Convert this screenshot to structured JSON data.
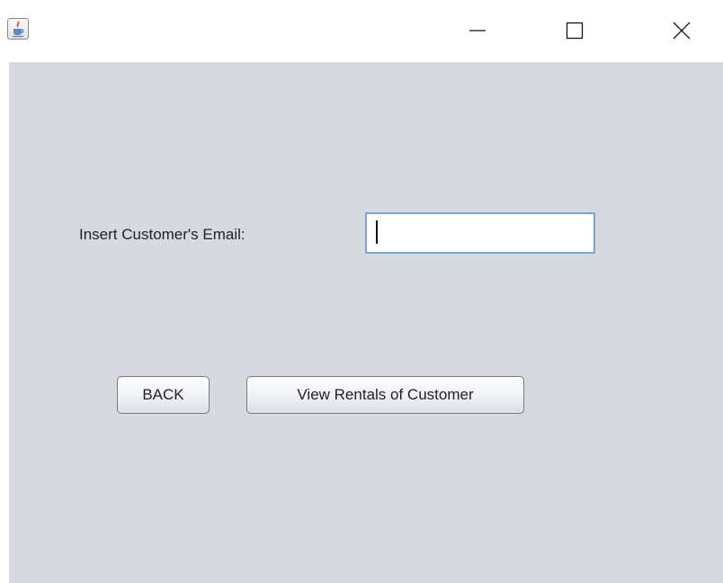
{
  "window": {
    "icon": "java-cup-icon",
    "controls": {
      "minimize": "minimize-icon",
      "maximize": "maximize-icon",
      "close": "close-icon"
    }
  },
  "form": {
    "email_label": "Insert Customer's Email:",
    "email_value": ""
  },
  "buttons": {
    "back_label": "BACK",
    "view_rentals_label": "View Rentals of Customer"
  },
  "colors": {
    "panel_background": "#d6d9e0",
    "input_focus_border": "#7aa7d6"
  }
}
